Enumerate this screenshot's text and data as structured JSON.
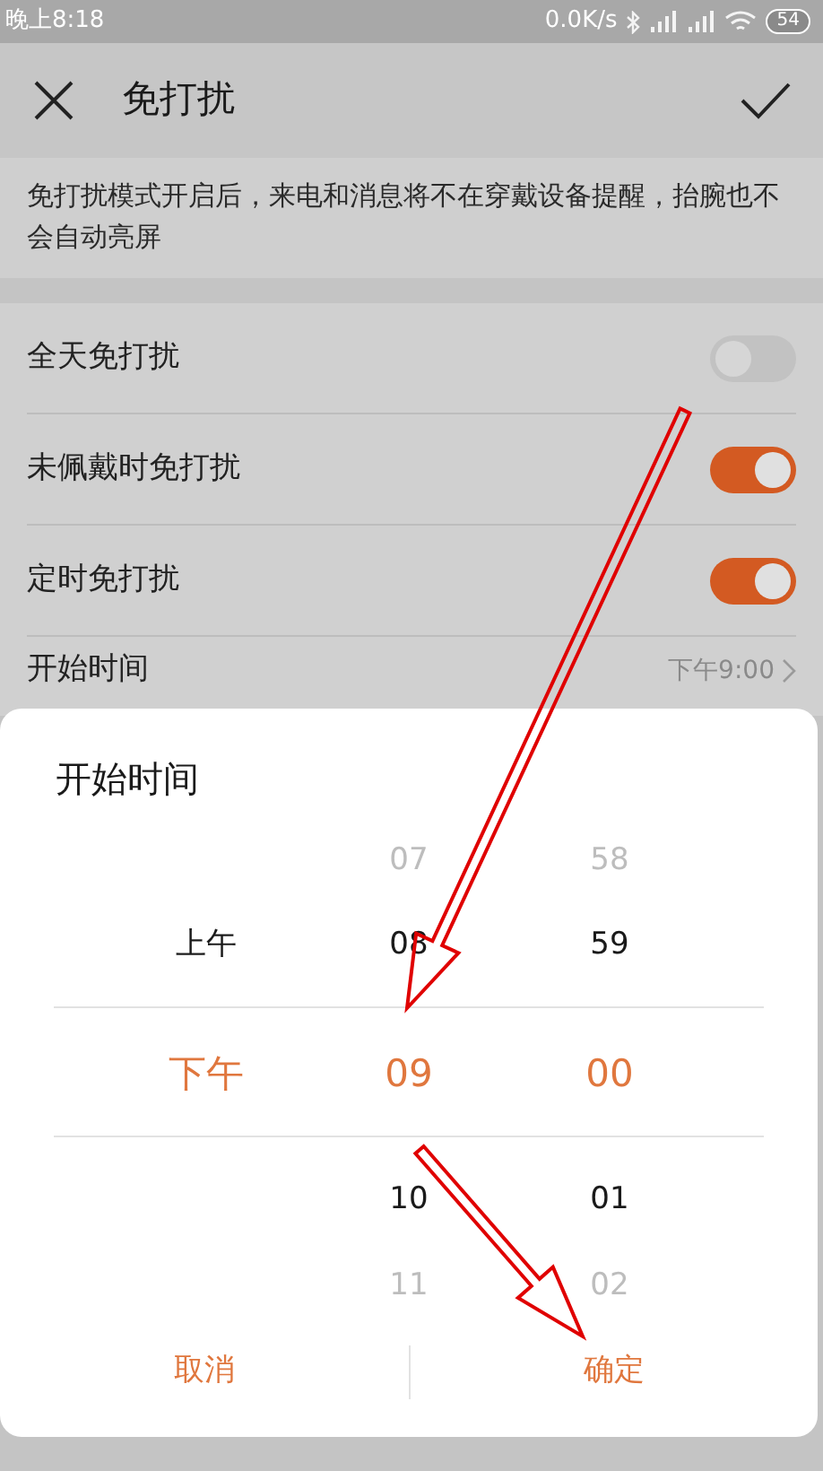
{
  "status_bar": {
    "time": "晚上8:18",
    "speed": "0.0K/s",
    "battery": "54"
  },
  "header": {
    "title": "免打扰"
  },
  "description": "免打扰模式开启后，来电和消息将不在穿戴设备提醒，抬腕也不会自动亮屏",
  "settings": [
    {
      "kind": "toggle",
      "label": "全天免打扰",
      "on": false
    },
    {
      "kind": "toggle",
      "label": "未佩戴时免打扰",
      "on": true
    },
    {
      "kind": "toggle",
      "label": "定时免打扰",
      "on": true
    },
    {
      "kind": "value",
      "label": "开始时间",
      "value": "下午9:00"
    }
  ],
  "dialog": {
    "title": "开始时间",
    "columns": [
      {
        "items": [
          {
            "text": "上午",
            "selected": false
          },
          {
            "text": "下午",
            "selected": true
          }
        ]
      },
      {
        "items": [
          {
            "text": "07",
            "selected": false
          },
          {
            "text": "08",
            "selected": false
          },
          {
            "text": "09",
            "selected": true
          },
          {
            "text": "10",
            "selected": false
          },
          {
            "text": "11",
            "selected": false
          }
        ]
      },
      {
        "items": [
          {
            "text": "58",
            "selected": false
          },
          {
            "text": "59",
            "selected": false
          },
          {
            "text": "00",
            "selected": true
          },
          {
            "text": "01",
            "selected": false
          },
          {
            "text": "02",
            "selected": false
          }
        ]
      }
    ],
    "buttons": [
      "取消",
      "确定"
    ]
  }
}
